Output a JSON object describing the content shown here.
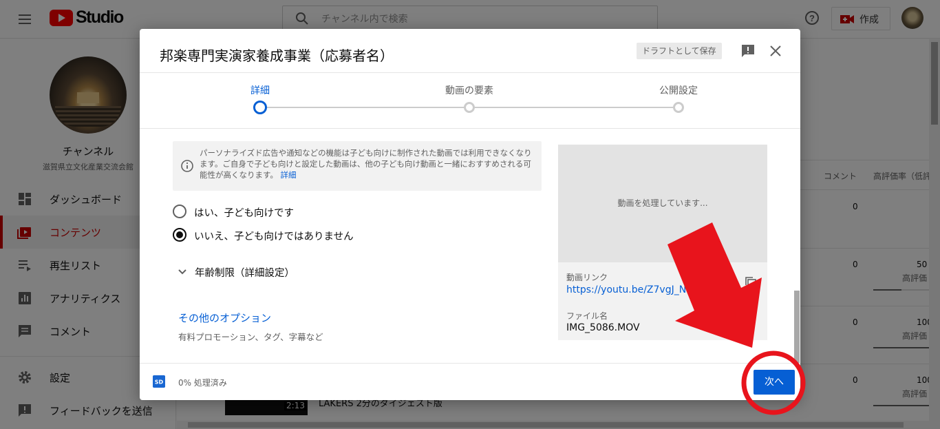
{
  "app": {
    "logo_text": "Studio",
    "search_placeholder": "チャンネル内で検索",
    "create_label": "作成"
  },
  "sidebar": {
    "channel_name": "チャンネル",
    "channel_sub": "滋賀県立文化産業交流会館",
    "items": [
      {
        "label": "ダッシュボード",
        "icon": "dashboard-icon"
      },
      {
        "label": "コンテンツ",
        "icon": "content-icon",
        "active": true
      },
      {
        "label": "再生リスト",
        "icon": "playlist-icon"
      },
      {
        "label": "アナリティクス",
        "icon": "analytics-icon"
      },
      {
        "label": "コメント",
        "icon": "comment-icon"
      },
      {
        "label": "設定",
        "icon": "gear-icon"
      },
      {
        "label": "フィードバックを送信",
        "icon": "feedback-icon"
      }
    ]
  },
  "table": {
    "headers": {
      "comments": "コメント",
      "rating": "高評価率（低評"
    },
    "rows": [
      {
        "comments": "0",
        "rating": "",
        "rating_label": ""
      },
      {
        "comments": "0",
        "rating": "50",
        "rating_label": "高評価",
        "rating_fraction": 0.5
      },
      {
        "comments": "0",
        "rating": "100",
        "rating_label": "高評価",
        "rating_fraction": 1.0
      },
      {
        "comments": "0",
        "rating": "100",
        "rating_label": "高評価",
        "rating_fraction": 1.0
      }
    ],
    "video_duration": "2:13",
    "video_title": "LAKERS 2分のダイジェスト版"
  },
  "dialog": {
    "title": "邦楽専門実演家養成事業（応募者名）",
    "draft_label": "ドラフトとして保存",
    "steps": [
      {
        "label": "詳細",
        "active": true
      },
      {
        "label": "動画の要素",
        "active": false
      },
      {
        "label": "公開設定",
        "active": false
      }
    ],
    "info_text": "パーソナライズド広告や通知などの機能は子ども向けに制作された動画では利用できなくなります。ご自身で子ども向けと設定した動画は、他の子ども向け動画と一緒におすすめされる可能性が高くなります。",
    "info_link": "詳細",
    "radio_yes": "はい、子ども向けです",
    "radio_no": "いいえ、子ども向けではありません",
    "selected_option": "いいえ、子ども向けではありません",
    "age_restriction": "年齢制限（詳細設定）",
    "more_options": "その他のオプション",
    "more_options_sub": "有料プロモーション、タグ、字幕など",
    "preview": {
      "processing": "動画を処理しています...",
      "link_label": "動画リンク",
      "link": "https://youtu.be/Z7vgJ_Nv",
      "file_label": "ファイル名",
      "file_name": "IMG_5086.MOV"
    },
    "footer": {
      "processed": "0% 処理済み",
      "next_label": "次へ"
    }
  },
  "colors": {
    "accent": "#065fd4",
    "brand_red": "#ff0000",
    "annotation_red": "#e8141c"
  }
}
